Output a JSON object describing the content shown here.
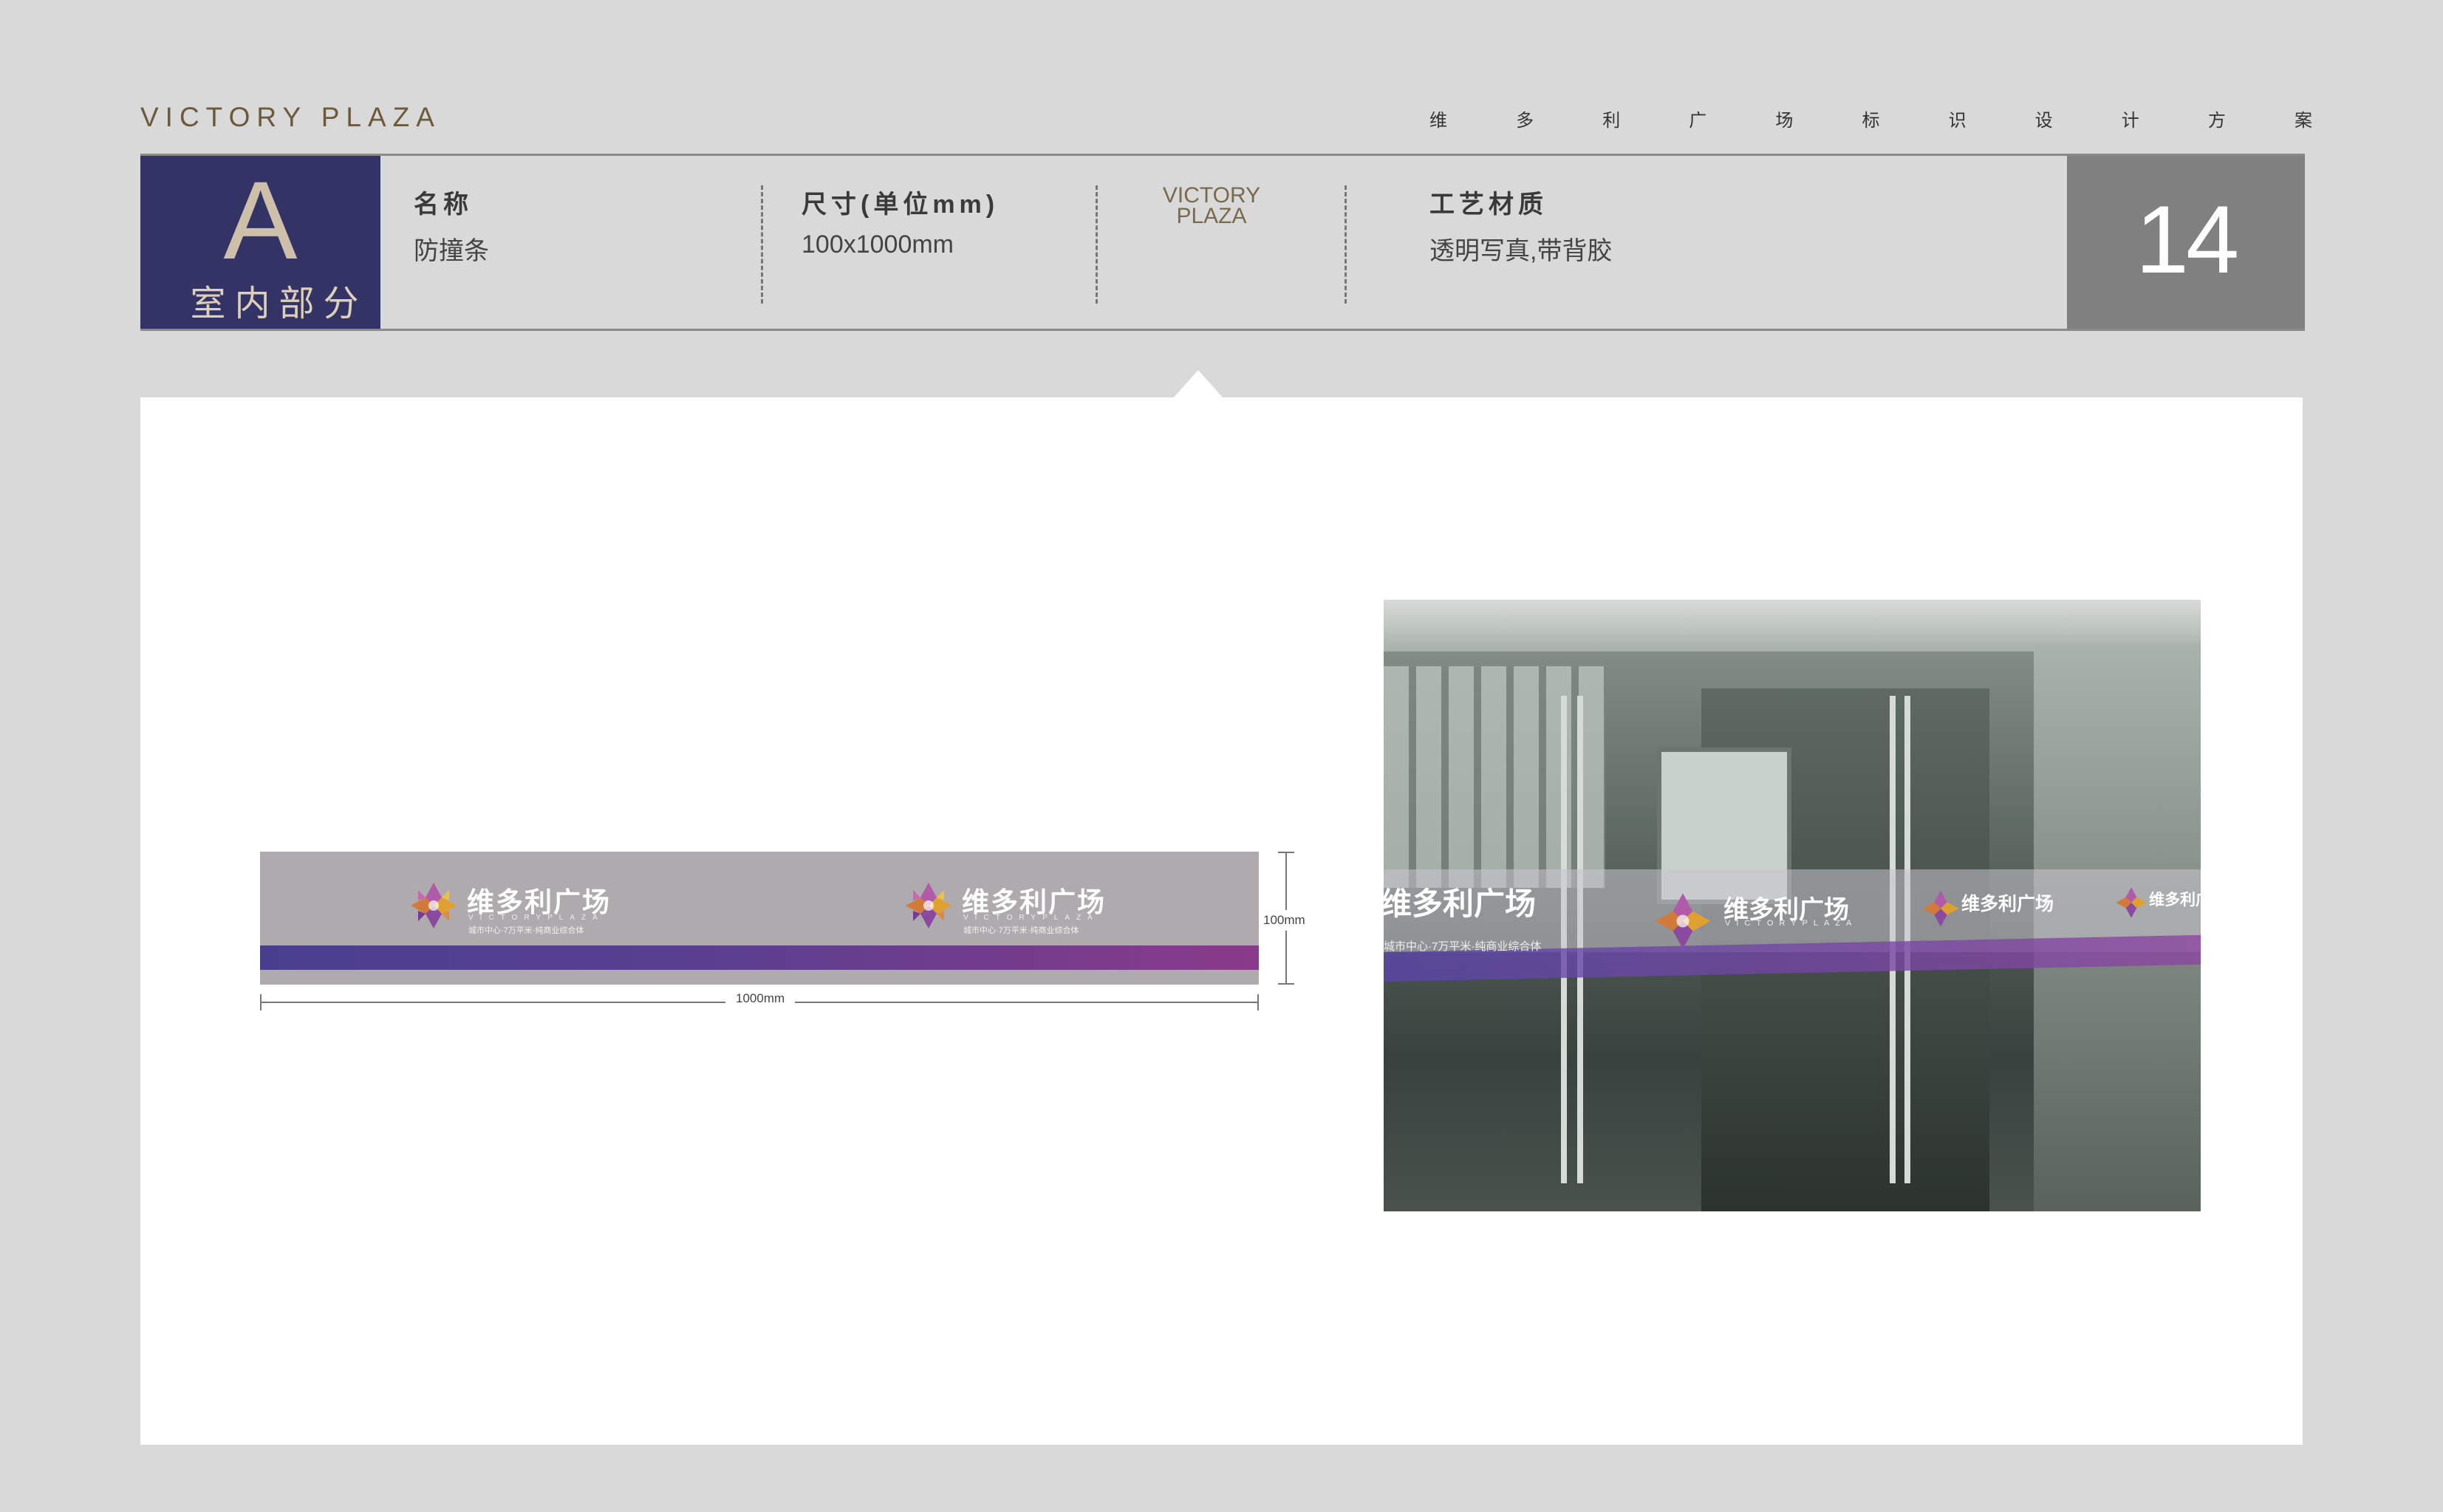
{
  "header": {
    "brand": "VICTORY PLAZA",
    "project_title_chars": [
      "维",
      "多",
      "利",
      "广",
      "场",
      "标",
      "识",
      "设",
      "计",
      "方",
      "案"
    ],
    "section_letter": "A",
    "section_name": "室内部分",
    "name_label": "名称",
    "name_value": "防撞条",
    "size_label": "尺寸(单位mm)",
    "size_value": "100x1000mm",
    "mini_logo_line1": "VICTORY",
    "mini_logo_line2": "PLAZA",
    "material_label": "工艺材质",
    "material_value": "透明写真,带背胶",
    "page_number": "14"
  },
  "strip": {
    "logo_cn": "维多利广场",
    "logo_en": "VICTORYPLAZA",
    "logo_sub": "城市中心·7万平米·纯商业综合体",
    "height_label": "100mm",
    "width_label": "1000mm"
  },
  "photo": {
    "logo_cn_partial": "维多利广场",
    "logo_cn_cut": "维多利广",
    "logo_en": "VICTORYPLAZA",
    "logo_sub": "城市中心·7万平米·纯商业综合体"
  },
  "colors": {
    "section_block": "#333366",
    "page_number_block": "#808080",
    "strip_gray": "#aeaaad",
    "stripe_start": "#4a3f8f",
    "stripe_end": "#8a3a8a"
  }
}
